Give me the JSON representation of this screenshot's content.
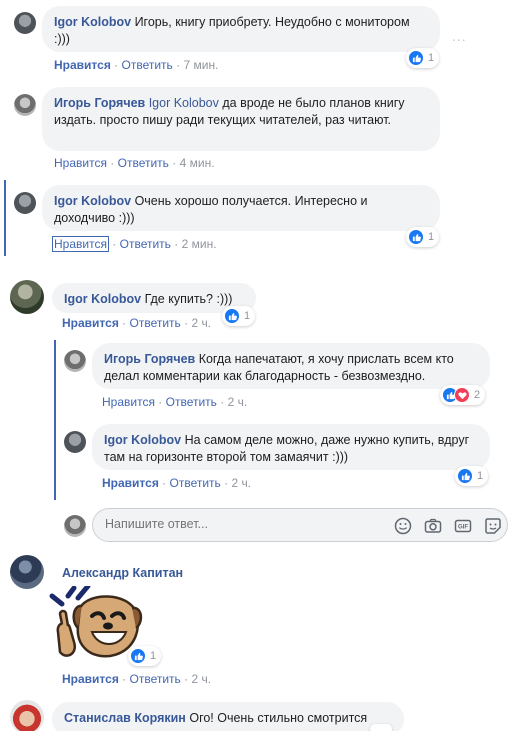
{
  "comments": [
    {
      "author": "Igor Kolobov",
      "text": "Игорь, книгу приобрету. Неудобно с монитором :)))",
      "like": "Нравится",
      "reply": "Ответить",
      "time": "7 мин.",
      "reactions": "1"
    },
    {
      "author": "Игорь Горячев",
      "mention": "Igor Kolobov",
      "text": "да вроде не было планов книгу издать. просто пишу ради текущих читателей, раз читают.",
      "like": "Нравится",
      "reply": "Ответить",
      "time": "4 мин."
    },
    {
      "author": "Igor Kolobov",
      "text": "Очень хорошо получается. Интересно и доходчиво :)))",
      "like": "Нравится",
      "reply": "Ответить",
      "time": "2 мин.",
      "reactions": "1"
    },
    {
      "author": "Igor Kolobov",
      "text": "Где купить? :)))",
      "like": "Нравится",
      "reply": "Ответить",
      "time": "2 ч.",
      "reactions": "1"
    },
    {
      "author": "Игорь Горячев",
      "text": "Когда напечатают, я хочу прислать всем кто делал комментарии как благодарность - безвозмездно.",
      "like": "Нравится",
      "reply": "Ответить",
      "time": "2 ч.",
      "reactions": "2"
    },
    {
      "author": "Igor Kolobov",
      "text": "На самом деле можно, даже нужно купить, вдруг там на горизонте второй том замаячит :)))",
      "like": "Нравится",
      "reply": "Ответить",
      "time": "2 ч.",
      "reactions": "1"
    },
    {
      "author": "Александр Капитан",
      "like": "Нравится",
      "reply": "Ответить",
      "time": "2 ч.",
      "reactions": "1"
    },
    {
      "author": "Станислав Корякин",
      "text": "Ого! Очень стильно смотрится"
    }
  ],
  "reply_box": {
    "placeholder": "Напишите ответ..."
  },
  "more_options": "...",
  "sep": "·",
  "colors": {
    "name": "#385898",
    "link": "#4267b2",
    "bubble": "#f2f3f5",
    "like_blue": "#1877f2",
    "love_red": "#f33e58"
  }
}
